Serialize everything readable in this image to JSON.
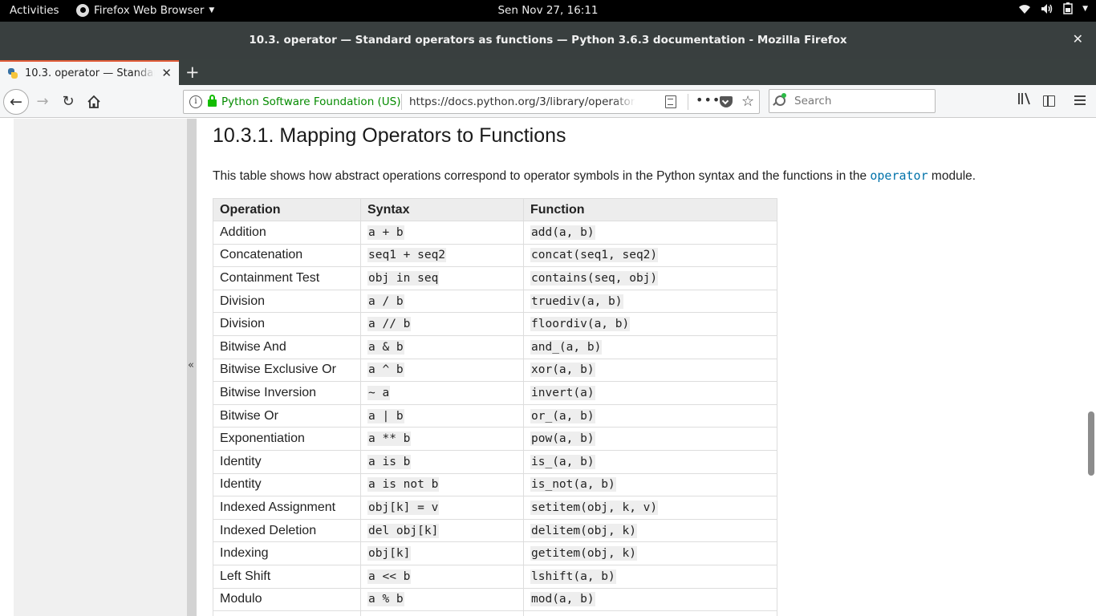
{
  "topbar": {
    "activities": "Activities",
    "app_name": "Firefox Web Browser",
    "clock": "Sen Nov 27, 16:11"
  },
  "window": {
    "title": "10.3. operator — Standard operators as functions — Python 3.6.3 documentation - Mozilla Firefox"
  },
  "tab": {
    "label": "10.3. operator — Standard operators as functions",
    "new_tab": "+"
  },
  "navbar": {
    "site_identity": "Python Software Foundation (US)",
    "url": "https://docs.python.org/3/library/operator.html",
    "search_placeholder": "Search"
  },
  "sidebar": {
    "collapse_label": "«"
  },
  "doc": {
    "section_title": "10.3.1. Mapping Operators to Functions",
    "intro_before": "This table shows how abstract operations correspond to operator symbols in the Python syntax and the functions in the ",
    "intro_code": "operator",
    "intro_after": " module.",
    "table": {
      "headers": [
        "Operation",
        "Syntax",
        "Function"
      ],
      "rows": [
        {
          "operation": "Addition",
          "syntax": "a + b",
          "function": "add(a, b)"
        },
        {
          "operation": "Concatenation",
          "syntax": "seq1 + seq2",
          "function": "concat(seq1, seq2)"
        },
        {
          "operation": "Containment Test",
          "syntax": "obj in seq",
          "function": "contains(seq, obj)"
        },
        {
          "operation": "Division",
          "syntax": "a / b",
          "function": "truediv(a, b)"
        },
        {
          "operation": "Division",
          "syntax": "a // b",
          "function": "floordiv(a, b)"
        },
        {
          "operation": "Bitwise And",
          "syntax": "a & b",
          "function": "and_(a, b)"
        },
        {
          "operation": "Bitwise Exclusive Or",
          "syntax": "a ^ b",
          "function": "xor(a, b)"
        },
        {
          "operation": "Bitwise Inversion",
          "syntax": "~ a",
          "function": "invert(a)"
        },
        {
          "operation": "Bitwise Or",
          "syntax": "a | b",
          "function": "or_(a, b)"
        },
        {
          "operation": "Exponentiation",
          "syntax": "a ** b",
          "function": "pow(a, b)"
        },
        {
          "operation": "Identity",
          "syntax": "a is b",
          "function": "is_(a, b)"
        },
        {
          "operation": "Identity",
          "syntax": "a is not b",
          "function": "is_not(a, b)"
        },
        {
          "operation": "Indexed Assignment",
          "syntax": "obj[k] = v",
          "function": "setitem(obj, k, v)"
        },
        {
          "operation": "Indexed Deletion",
          "syntax": "del obj[k]",
          "function": "delitem(obj, k)"
        },
        {
          "operation": "Indexing",
          "syntax": "obj[k]",
          "function": "getitem(obj, k)"
        },
        {
          "operation": "Left Shift",
          "syntax": "a << b",
          "function": "lshift(a, b)"
        },
        {
          "operation": "Modulo",
          "syntax": "a % b",
          "function": "mod(a, b)"
        },
        {
          "operation": "",
          "syntax": "",
          "function": ""
        }
      ]
    }
  },
  "colors": {
    "tab_accent": "#e25d39",
    "secure_green": "#058b00",
    "code_link": "#0072aa"
  }
}
